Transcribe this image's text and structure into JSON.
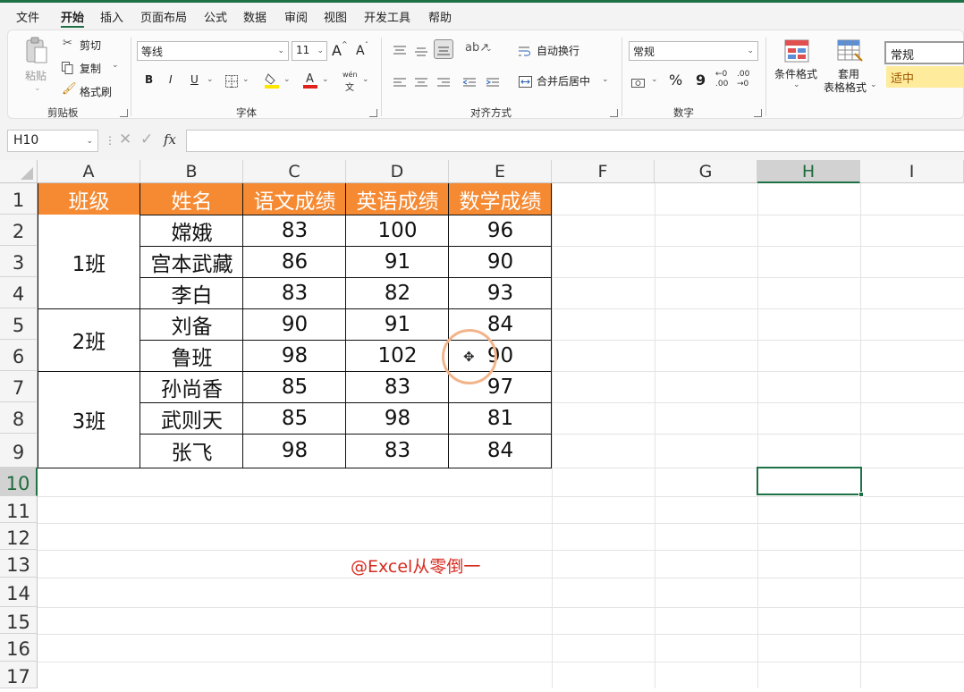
{
  "menu": {
    "items": [
      "文件",
      "开始",
      "插入",
      "页面布局",
      "公式",
      "数据",
      "审阅",
      "视图",
      "开发工具",
      "帮助"
    ],
    "active": "开始"
  },
  "ribbon": {
    "clipboard": {
      "paste": "粘贴",
      "cut": "剪切",
      "copy": "复制",
      "format_painter": "格式刷",
      "label": "剪贴板"
    },
    "font": {
      "name": "等线",
      "size": "11",
      "bold": "B",
      "italic": "I",
      "underline": "U",
      "grow": "A",
      "shrink": "A",
      "phonetic_top": "wén",
      "phonetic_bottom": "文",
      "label": "字体"
    },
    "alignment": {
      "wrap": "自动换行",
      "merge": "合并后居中",
      "label": "对齐方式"
    },
    "number": {
      "format": "常规",
      "percent": "%",
      "comma": "9",
      "inc_decimal_top": "←0",
      "inc_decimal_bottom": ".00",
      "dec_decimal_top": ".00",
      "dec_decimal_bottom": "→0",
      "label": "数字"
    },
    "styles": {
      "conditional": "条件格式",
      "table_top": "套用",
      "table_bottom": "表格格式",
      "style_normal": "常规",
      "style_neutral": "适中"
    }
  },
  "formula_bar": {
    "name_box": "H10",
    "fx": "fx",
    "value": ""
  },
  "grid": {
    "columns": [
      "A",
      "B",
      "C",
      "D",
      "E",
      "F",
      "G",
      "H",
      "I"
    ],
    "selected_column": "H",
    "rows": [
      "1",
      "2",
      "3",
      "4",
      "5",
      "6",
      "7",
      "8",
      "9",
      "10",
      "11",
      "12",
      "13",
      "14",
      "15",
      "16",
      "17"
    ],
    "selected_row": "10",
    "headers": [
      "班级",
      "姓名",
      "语文成绩",
      "英语成绩",
      "数学成绩"
    ],
    "classes": [
      "1班",
      "2班",
      "3班"
    ],
    "records": [
      [
        "嫦娥",
        "83",
        "100",
        "96"
      ],
      [
        "宫本武藏",
        "86",
        "91",
        "90"
      ],
      [
        "李白",
        "83",
        "82",
        "93"
      ],
      [
        "刘备",
        "90",
        "91",
        "84"
      ],
      [
        "鲁班",
        "98",
        "102",
        "90"
      ],
      [
        "孙尚香",
        "85",
        "83",
        "97"
      ],
      [
        "武则天",
        "85",
        "98",
        "81"
      ],
      [
        "张飞",
        "98",
        "83",
        "84"
      ]
    ],
    "header_color": "#F58A33"
  },
  "watermark": "@Excel从零倒一",
  "colors": {
    "accent": "#1E7145",
    "cursor_ring": "#F2B48A",
    "watermark": "#D62B1F"
  }
}
